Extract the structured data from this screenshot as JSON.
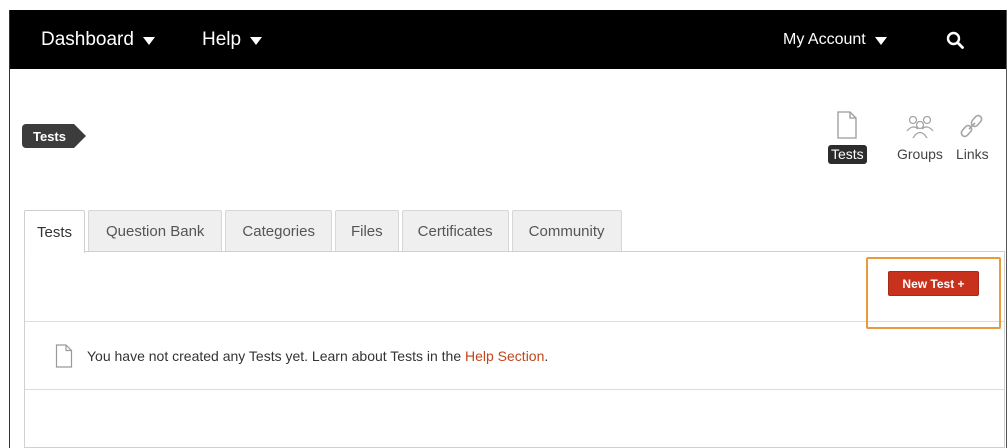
{
  "topnav": {
    "dashboard_label": "Dashboard",
    "help_label": "Help",
    "account_label": "My Account",
    "search_icon": "search-icon"
  },
  "breadcrumb": {
    "label": "Tests"
  },
  "type_switch": [
    {
      "label": "Tests",
      "icon": "document-icon",
      "active": true
    },
    {
      "label": "Groups",
      "icon": "groups-icon",
      "active": false
    },
    {
      "label": "Links",
      "icon": "link-icon",
      "active": false
    }
  ],
  "tabs": [
    {
      "label": "Tests",
      "active": true
    },
    {
      "label": "Question Bank",
      "active": false
    },
    {
      "label": "Categories",
      "active": false
    },
    {
      "label": "Files",
      "active": false
    },
    {
      "label": "Certificates",
      "active": false
    },
    {
      "label": "Community",
      "active": false
    }
  ],
  "actions": {
    "new_test_label": "New Test +"
  },
  "empty_state": {
    "text": "You have not created any Tests yet. Learn about Tests in the ",
    "link_label": "Help Section",
    "suffix": "."
  },
  "colors": {
    "nav_bg": "#000000",
    "accent_button": "#c8321c",
    "highlight_border": "#e89a3c",
    "link": "#c0461d"
  }
}
